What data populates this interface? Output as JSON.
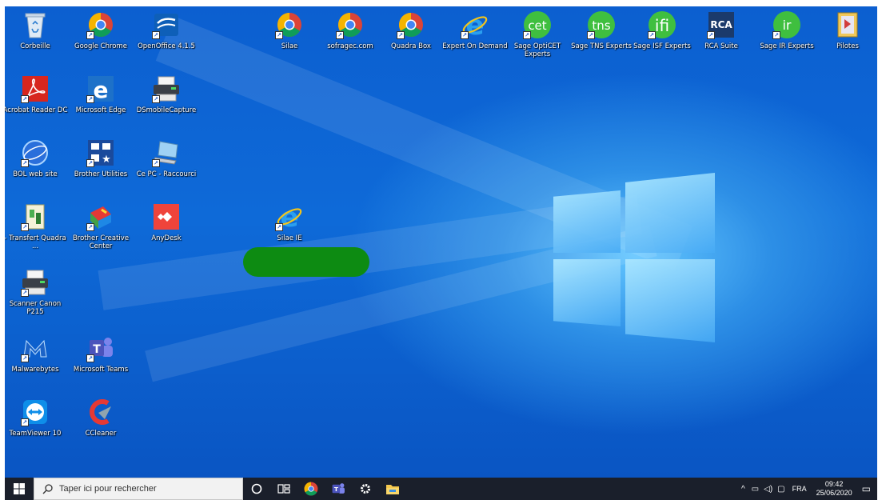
{
  "desktop": {
    "icons": [
      {
        "label": "Corbeille",
        "icon": "recycle-bin-icon"
      },
      {
        "label": "Google Chrome",
        "icon": "chrome-icon"
      },
      {
        "label": "OpenOffice 4.1.5",
        "icon": "openoffice-icon"
      },
      {
        "label": "Silae",
        "icon": "chrome-icon"
      },
      {
        "label": "sofragec.com",
        "icon": "chrome-icon"
      },
      {
        "label": "Quadra Box",
        "icon": "chrome-icon"
      },
      {
        "label": "Expert On Demand",
        "icon": "internet-explorer-icon"
      },
      {
        "label": "Sage OptiCET Experts",
        "icon": "sage-cet-icon",
        "glyph": "cet"
      },
      {
        "label": "Sage TNS Experts",
        "icon": "sage-tns-icon",
        "glyph": "tns"
      },
      {
        "label": "Sage ISF Experts",
        "icon": "sage-ifi-icon",
        "glyph": "ifi"
      },
      {
        "label": "RCA Suite",
        "icon": "rca-icon",
        "glyph": "RCA"
      },
      {
        "label": "Sage IR Experts",
        "icon": "sage-ir-icon",
        "glyph": "ir"
      },
      {
        "label": "Pilotes",
        "icon": "pilotes-icon"
      },
      {
        "label": "Acrobat Reader DC",
        "icon": "acrobat-icon"
      },
      {
        "label": "Microsoft Edge",
        "icon": "edge-icon"
      },
      {
        "label": "DSmobileCapture",
        "icon": "scanner-icon"
      },
      {
        "label": "BOL web site",
        "icon": "bol-icon"
      },
      {
        "label": "Brother Utilities",
        "icon": "brother-utilities-icon"
      },
      {
        "label": "Ce PC - Raccourci",
        "icon": "computer-icon"
      },
      {
        "label": "- Transfert Quadra ...",
        "icon": "transfer-icon"
      },
      {
        "label": "Brother Creative Center",
        "icon": "brother-creative-icon"
      },
      {
        "label": "AnyDesk",
        "icon": "anydesk-icon"
      },
      {
        "label": "Silae IE",
        "icon": "internet-explorer-icon"
      },
      {
        "label": "Scanner Canon P215",
        "icon": "scanner-icon"
      },
      {
        "label": "Malwarebytes",
        "icon": "malwarebytes-icon"
      },
      {
        "label": "Microsoft Teams",
        "icon": "teams-icon"
      },
      {
        "label": "TeamViewer 10",
        "icon": "teamviewer-icon"
      },
      {
        "label": "CCleaner",
        "icon": "ccleaner-icon"
      }
    ]
  },
  "taskbar": {
    "search_placeholder": "Taper ici pour rechercher",
    "pinned": [
      "cortana-icon",
      "task-view-icon",
      "chrome-icon",
      "teams-icon",
      "settings-icon",
      "file-explorer-icon"
    ],
    "tray": {
      "language": "FRA",
      "time": "09:42",
      "date": "25/06/2020"
    }
  },
  "colors": {
    "wallpaper": "#0e6ad8",
    "taskbar": "#1a1f2b",
    "redaction": "#0d8b12"
  }
}
